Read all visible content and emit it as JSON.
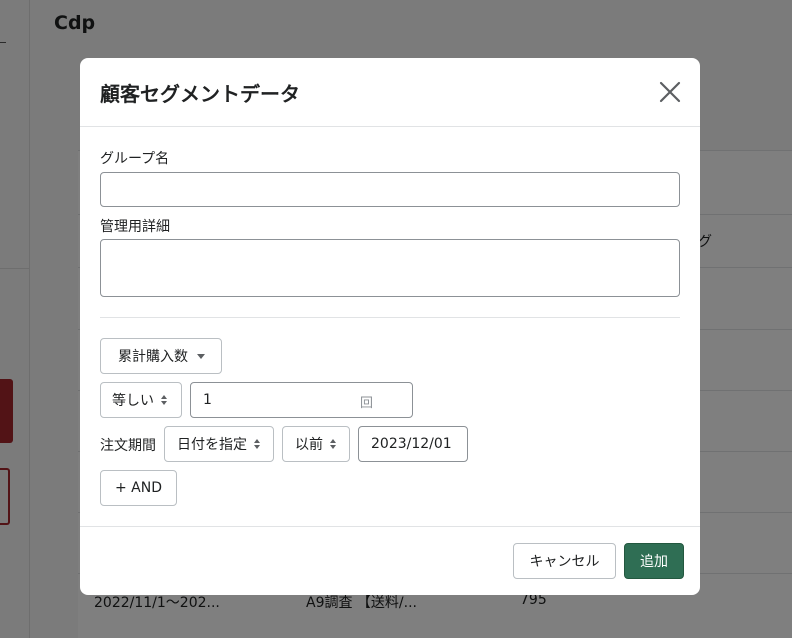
{
  "background": {
    "page_title": "Cdp",
    "header_partial": "グ",
    "row_values": {
      "period": "2022/11/1～202...",
      "name": "A9調査 【送料/...",
      "count": "795"
    }
  },
  "modal": {
    "title": "顧客セグメントデータ",
    "group_name_label": "グループ名",
    "group_name_value": "",
    "admin_detail_label": "管理用詳細",
    "admin_detail_value": "",
    "metric_dropdown": "累計購入数",
    "operator_select": "等しい",
    "count_value": "1",
    "count_unit": "回",
    "order_period_label": "注文期間",
    "date_mode_select": "日付を指定",
    "relation_select": "以前",
    "date_value": "2023/12/01",
    "and_button": "+ AND",
    "cancel_button": "キャンセル",
    "add_button": "追加"
  },
  "colors": {
    "primary": "#2f6e54",
    "danger": "#a4262c"
  }
}
